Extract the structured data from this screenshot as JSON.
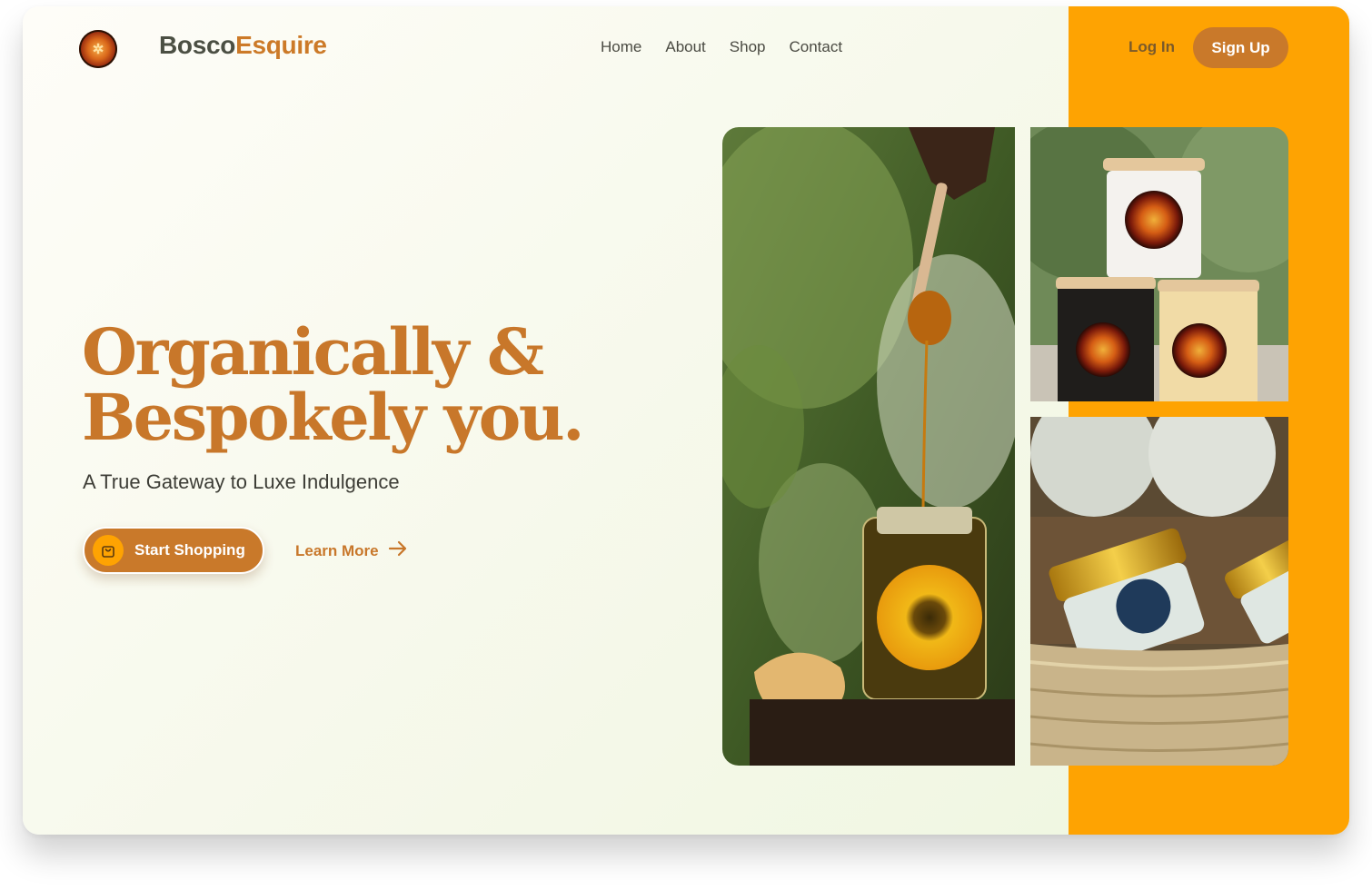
{
  "brand": {
    "part1": "Bosco",
    "part2": "Esquire",
    "logo_icon": "bee-seal-logo"
  },
  "nav": {
    "items": [
      {
        "label": "Home"
      },
      {
        "label": "About"
      },
      {
        "label": "Shop"
      },
      {
        "label": "Contact"
      }
    ]
  },
  "auth": {
    "login_label": "Log In",
    "signup_label": "Sign Up"
  },
  "hero": {
    "headline_line1": "Organically &",
    "headline_line2": "Bespokely you.",
    "subheadline": "A True Gateway to Luxe Indulgence",
    "cta_primary": {
      "label": "Start Shopping",
      "icon": "shopping-bag-icon"
    },
    "cta_secondary": {
      "label": "Learn More",
      "icon": "arrow-right-icon"
    }
  },
  "photos": [
    {
      "name": "honey-jar-with-dipper-photo"
    },
    {
      "name": "stacked-candles-photo"
    },
    {
      "name": "cream-jars-in-basket-photo"
    }
  ],
  "colors": {
    "accent": "#c9792a",
    "orange_panel": "#fea302",
    "text_dark": "#4b4f43"
  }
}
